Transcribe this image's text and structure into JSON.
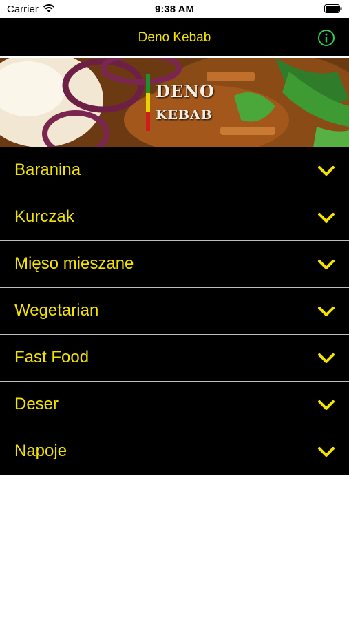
{
  "status_bar": {
    "carrier": "Carrier",
    "time": "9:38 AM"
  },
  "nav": {
    "title": "Deno Kebab",
    "info_icon": "info-circle-icon",
    "info_color": "#34c759"
  },
  "banner": {
    "logo_line1": "DENO",
    "logo_line2": "KEBAB"
  },
  "menu": {
    "accent_color": "#f2e300",
    "items": [
      {
        "label": "Baranina"
      },
      {
        "label": "Kurczak"
      },
      {
        "label": "Mięso mieszane"
      },
      {
        "label": "Wegetarian"
      },
      {
        "label": "Fast Food"
      },
      {
        "label": "Deser"
      },
      {
        "label": "Napoje"
      }
    ]
  }
}
